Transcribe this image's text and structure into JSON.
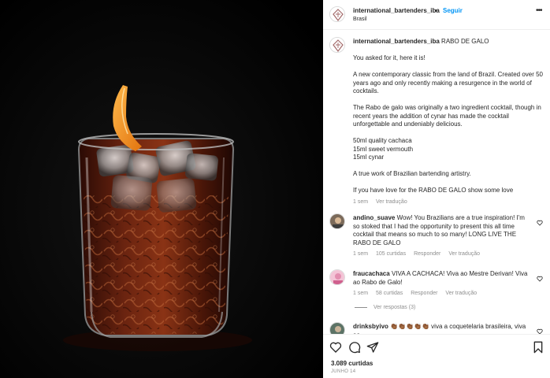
{
  "post": {
    "author": "international_bartenders_iba",
    "follow_label": "Seguir",
    "separator": "•",
    "location": "Brasil",
    "more_label": "•••",
    "image_alt": "Rabo de Galo cocktail in a carved rocks glass with ice and an orange peel"
  },
  "caption": {
    "username": "international_bartenders_iba",
    "title": "RABO DE GALO",
    "line1": "You asked for it, here it is!",
    "para2": "A new contemporary classic from the land of Brazil. Created over 50 years ago and only recently making a resurgence in the world of cocktails.",
    "para3": "The Rabo de galo was originally a two ingredient cocktail, though in recent years the addition of cynar has made the cocktail unforgettable and undeniably delicious.",
    "ingredient1": "50ml quality cachaca",
    "ingredient2": "15ml sweet vermouth",
    "ingredient3": "15ml cynar",
    "para5": "A true work of Brazilian bartending artistry.",
    "para6": "If you have love for the RABO DE GALO show some love",
    "time": "1 sem",
    "translate": "Ver tradução"
  },
  "comments": [
    {
      "username": "andino_suave",
      "text": "Wow! You Brazilians are a true inspiration! I'm so stoked that I had the opportunity to present this all time cocktail that means so much to so many! LONG LIVE THE RABO DE GALO",
      "time": "1 sem",
      "likes": "105 curtidas",
      "reply": "Responder",
      "translate": "Ver tradução"
    },
    {
      "username": "fraucachaca",
      "text": "VIVA A CACHACA! Viva ao Mestre Derivan! Viva ao Rabo de Galo!",
      "time": "1 sem",
      "likes": "58 curtidas",
      "reply": "Responder",
      "translate": "Ver tradução",
      "view_replies": "Ver respostas (3)"
    },
    {
      "username": "drinksbyivo",
      "text": "👏🏾👏🏾👏🏾👏🏾👏🏾 viva a coquetelaria brasileira, viva ao"
    }
  ],
  "footer": {
    "likes": "3.089 curtidas",
    "date": "JUNHO 14"
  },
  "icons": {
    "like": "heart-icon",
    "comment": "comment-icon",
    "share": "paper-plane-icon",
    "save": "bookmark-icon"
  },
  "colors": {
    "link_blue": "#0095f6",
    "muted": "#8e8e8e",
    "text": "#262626",
    "photo_bg": "#000000",
    "drink": "#5a1c0c",
    "orange_peel": "#f39a23"
  }
}
